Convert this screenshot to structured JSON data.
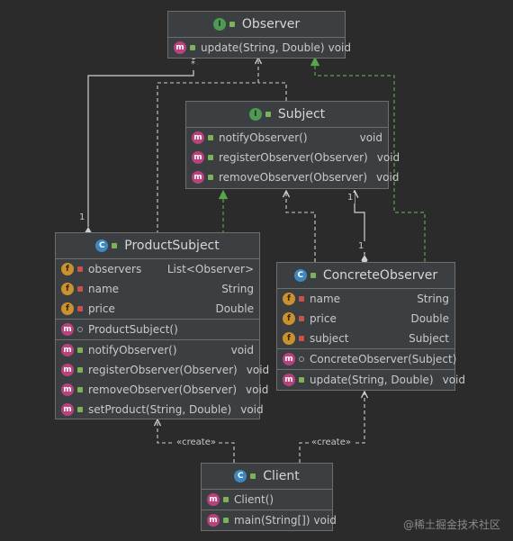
{
  "classes": {
    "observer": {
      "name": "Observer",
      "kind": "I",
      "methods": [
        {
          "name": "update(String, Double)",
          "type": "void"
        }
      ]
    },
    "subject": {
      "name": "Subject",
      "kind": "I",
      "methods": [
        {
          "name": "notifyObserver()",
          "type": "void"
        },
        {
          "name": "registerObserver(Observer)",
          "type": "void"
        },
        {
          "name": "removeObserver(Observer)",
          "type": "void"
        }
      ]
    },
    "product_subject": {
      "name": "ProductSubject",
      "kind": "C",
      "fields": [
        {
          "name": "observers",
          "type": "List<Observer>"
        },
        {
          "name": "name",
          "type": "String"
        },
        {
          "name": "price",
          "type": "Double"
        }
      ],
      "constructors": [
        {
          "name": "ProductSubject()"
        }
      ],
      "methods": [
        {
          "name": "notifyObserver()",
          "type": "void"
        },
        {
          "name": "registerObserver(Observer)",
          "type": "void"
        },
        {
          "name": "removeObserver(Observer)",
          "type": "void"
        },
        {
          "name": "setProduct(String, Double)",
          "type": "void"
        }
      ]
    },
    "concrete_observer": {
      "name": "ConcreteObserver",
      "kind": "C",
      "fields": [
        {
          "name": "name",
          "type": "String"
        },
        {
          "name": "price",
          "type": "Double"
        },
        {
          "name": "subject",
          "type": "Subject"
        }
      ],
      "constructors": [
        {
          "name": "ConcreteObserver(Subject)"
        }
      ],
      "methods": [
        {
          "name": "update(String, Double)",
          "type": "void"
        }
      ]
    },
    "client": {
      "name": "Client",
      "kind": "C",
      "constructors": [
        {
          "name": "Client()"
        }
      ],
      "methods": [
        {
          "name": "main(String[])",
          "type": "void"
        }
      ]
    }
  },
  "edges": {
    "mult_1_left": "1",
    "mult_star": "*",
    "mult_1_right": "1",
    "mult_1_co": "1",
    "create_left": "«create»",
    "create_right": "«create»"
  },
  "watermark": "@稀土掘金技术社区"
}
